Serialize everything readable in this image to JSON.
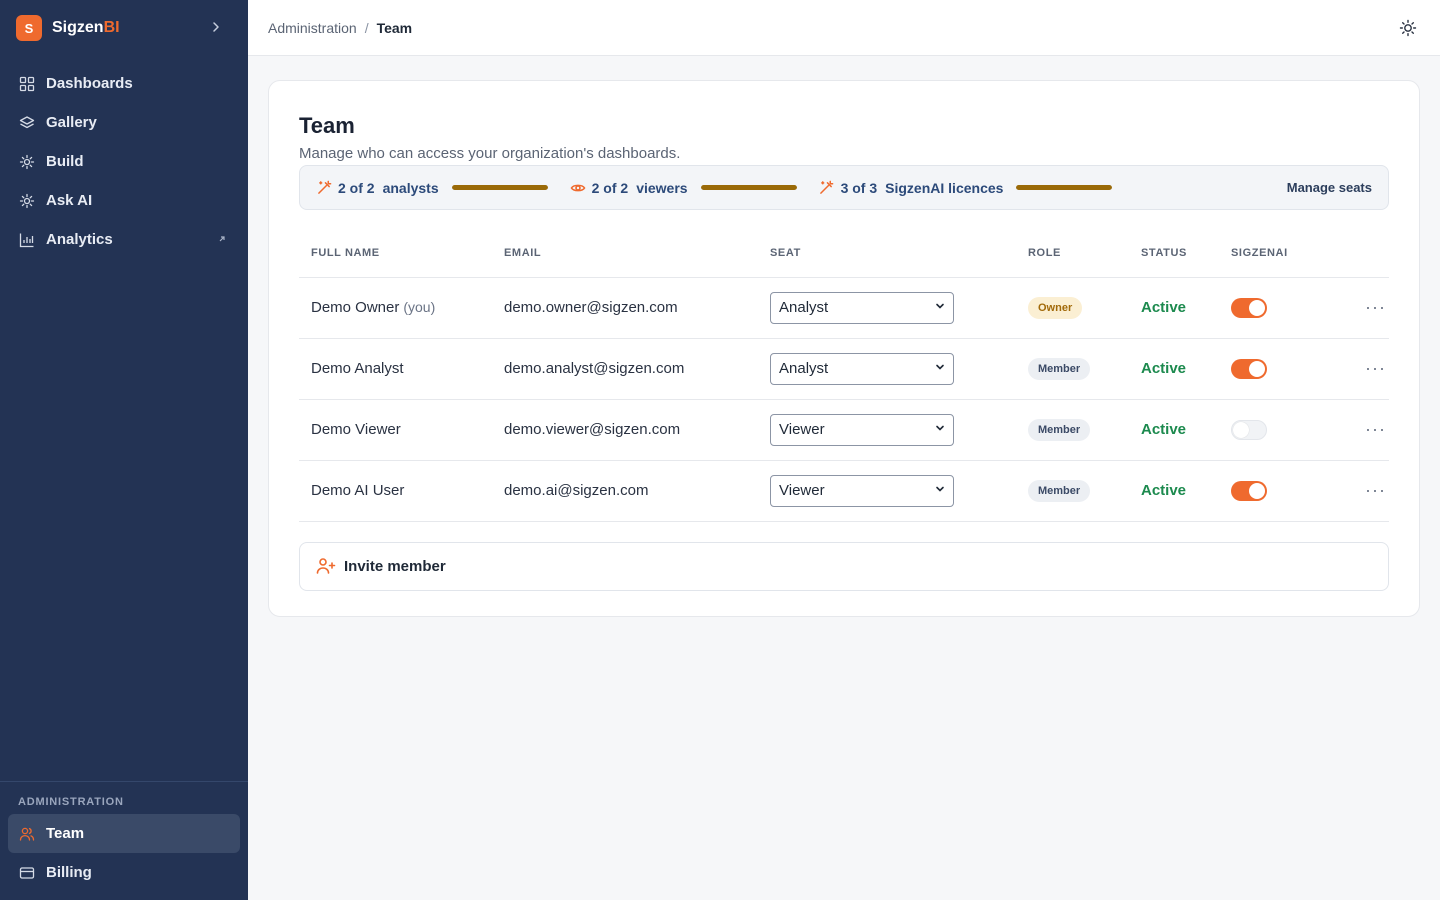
{
  "app": {
    "logo_letter": "S",
    "name_main": "Sigzen",
    "name_accent": "BI",
    "collapse_icon": "chevron-right-icon"
  },
  "sidebar": {
    "items": [
      {
        "label": "Dashboards",
        "icon": "grid-icon"
      },
      {
        "label": "Gallery",
        "icon": "layers-icon"
      },
      {
        "label": "Build",
        "icon": "sparkle-icon"
      },
      {
        "label": "Ask AI",
        "icon": "sparkle-icon"
      },
      {
        "label": "Analytics",
        "icon": "bar-chart-icon",
        "external_icon": "external-arrow-icon"
      }
    ],
    "admin_label": "ADMINISTRATION",
    "admin_items": [
      {
        "label": "Team",
        "icon": "users-icon",
        "active": true
      },
      {
        "label": "Billing",
        "icon": "card-icon",
        "active": false
      }
    ]
  },
  "header": {
    "breadcrumb_parent": "Administration",
    "breadcrumb_sep": "/",
    "breadcrumb_current": "Team",
    "theme_icon": "sun-icon"
  },
  "page": {
    "title": "Team",
    "subtitle": "Manage who can access your organization's dashboards."
  },
  "seats": {
    "items": [
      {
        "icon": "wand-icon",
        "count": "2 of 2",
        "label": "analysts",
        "fill": 1.0
      },
      {
        "icon": "eye-icon",
        "count": "2 of 2",
        "label": "viewers",
        "fill": 1.0
      },
      {
        "icon": "wand-icon",
        "count": "3 of 3",
        "label": "SigzenAI licences",
        "fill": 1.0
      }
    ],
    "manage_label": "Manage seats",
    "bar_color": "#9a6a08"
  },
  "table": {
    "headers": {
      "name": "FULL NAME",
      "email": "EMAIL",
      "seat": "SEAT",
      "role": "ROLE",
      "status": "STATUS",
      "ai": "SIGZENAI"
    },
    "rows": [
      {
        "name": "Demo Owner",
        "you": "(you)",
        "email": "demo.owner@sigzen.com",
        "seat": "Analyst",
        "role": "Owner",
        "status": "Active",
        "ai": true
      },
      {
        "name": "Demo Analyst",
        "you": "",
        "email": "demo.analyst@sigzen.com",
        "seat": "Analyst",
        "role": "Member",
        "status": "Active",
        "ai": true
      },
      {
        "name": "Demo Viewer",
        "you": "",
        "email": "demo.viewer@sigzen.com",
        "seat": "Viewer",
        "role": "Member",
        "status": "Active",
        "ai": false
      },
      {
        "name": "Demo AI User",
        "you": "",
        "email": "demo.ai@sigzen.com",
        "seat": "Viewer",
        "role": "Member",
        "status": "Active",
        "ai": true
      }
    ],
    "more_glyph": "···"
  },
  "invite": {
    "label": "Invite member",
    "icon": "user-plus-icon"
  },
  "colors": {
    "accent": "#ef6a2e",
    "sidebar_bg": "#233354",
    "active_status": "#1c8a4e",
    "toggle_on": "#ef6a2e"
  }
}
